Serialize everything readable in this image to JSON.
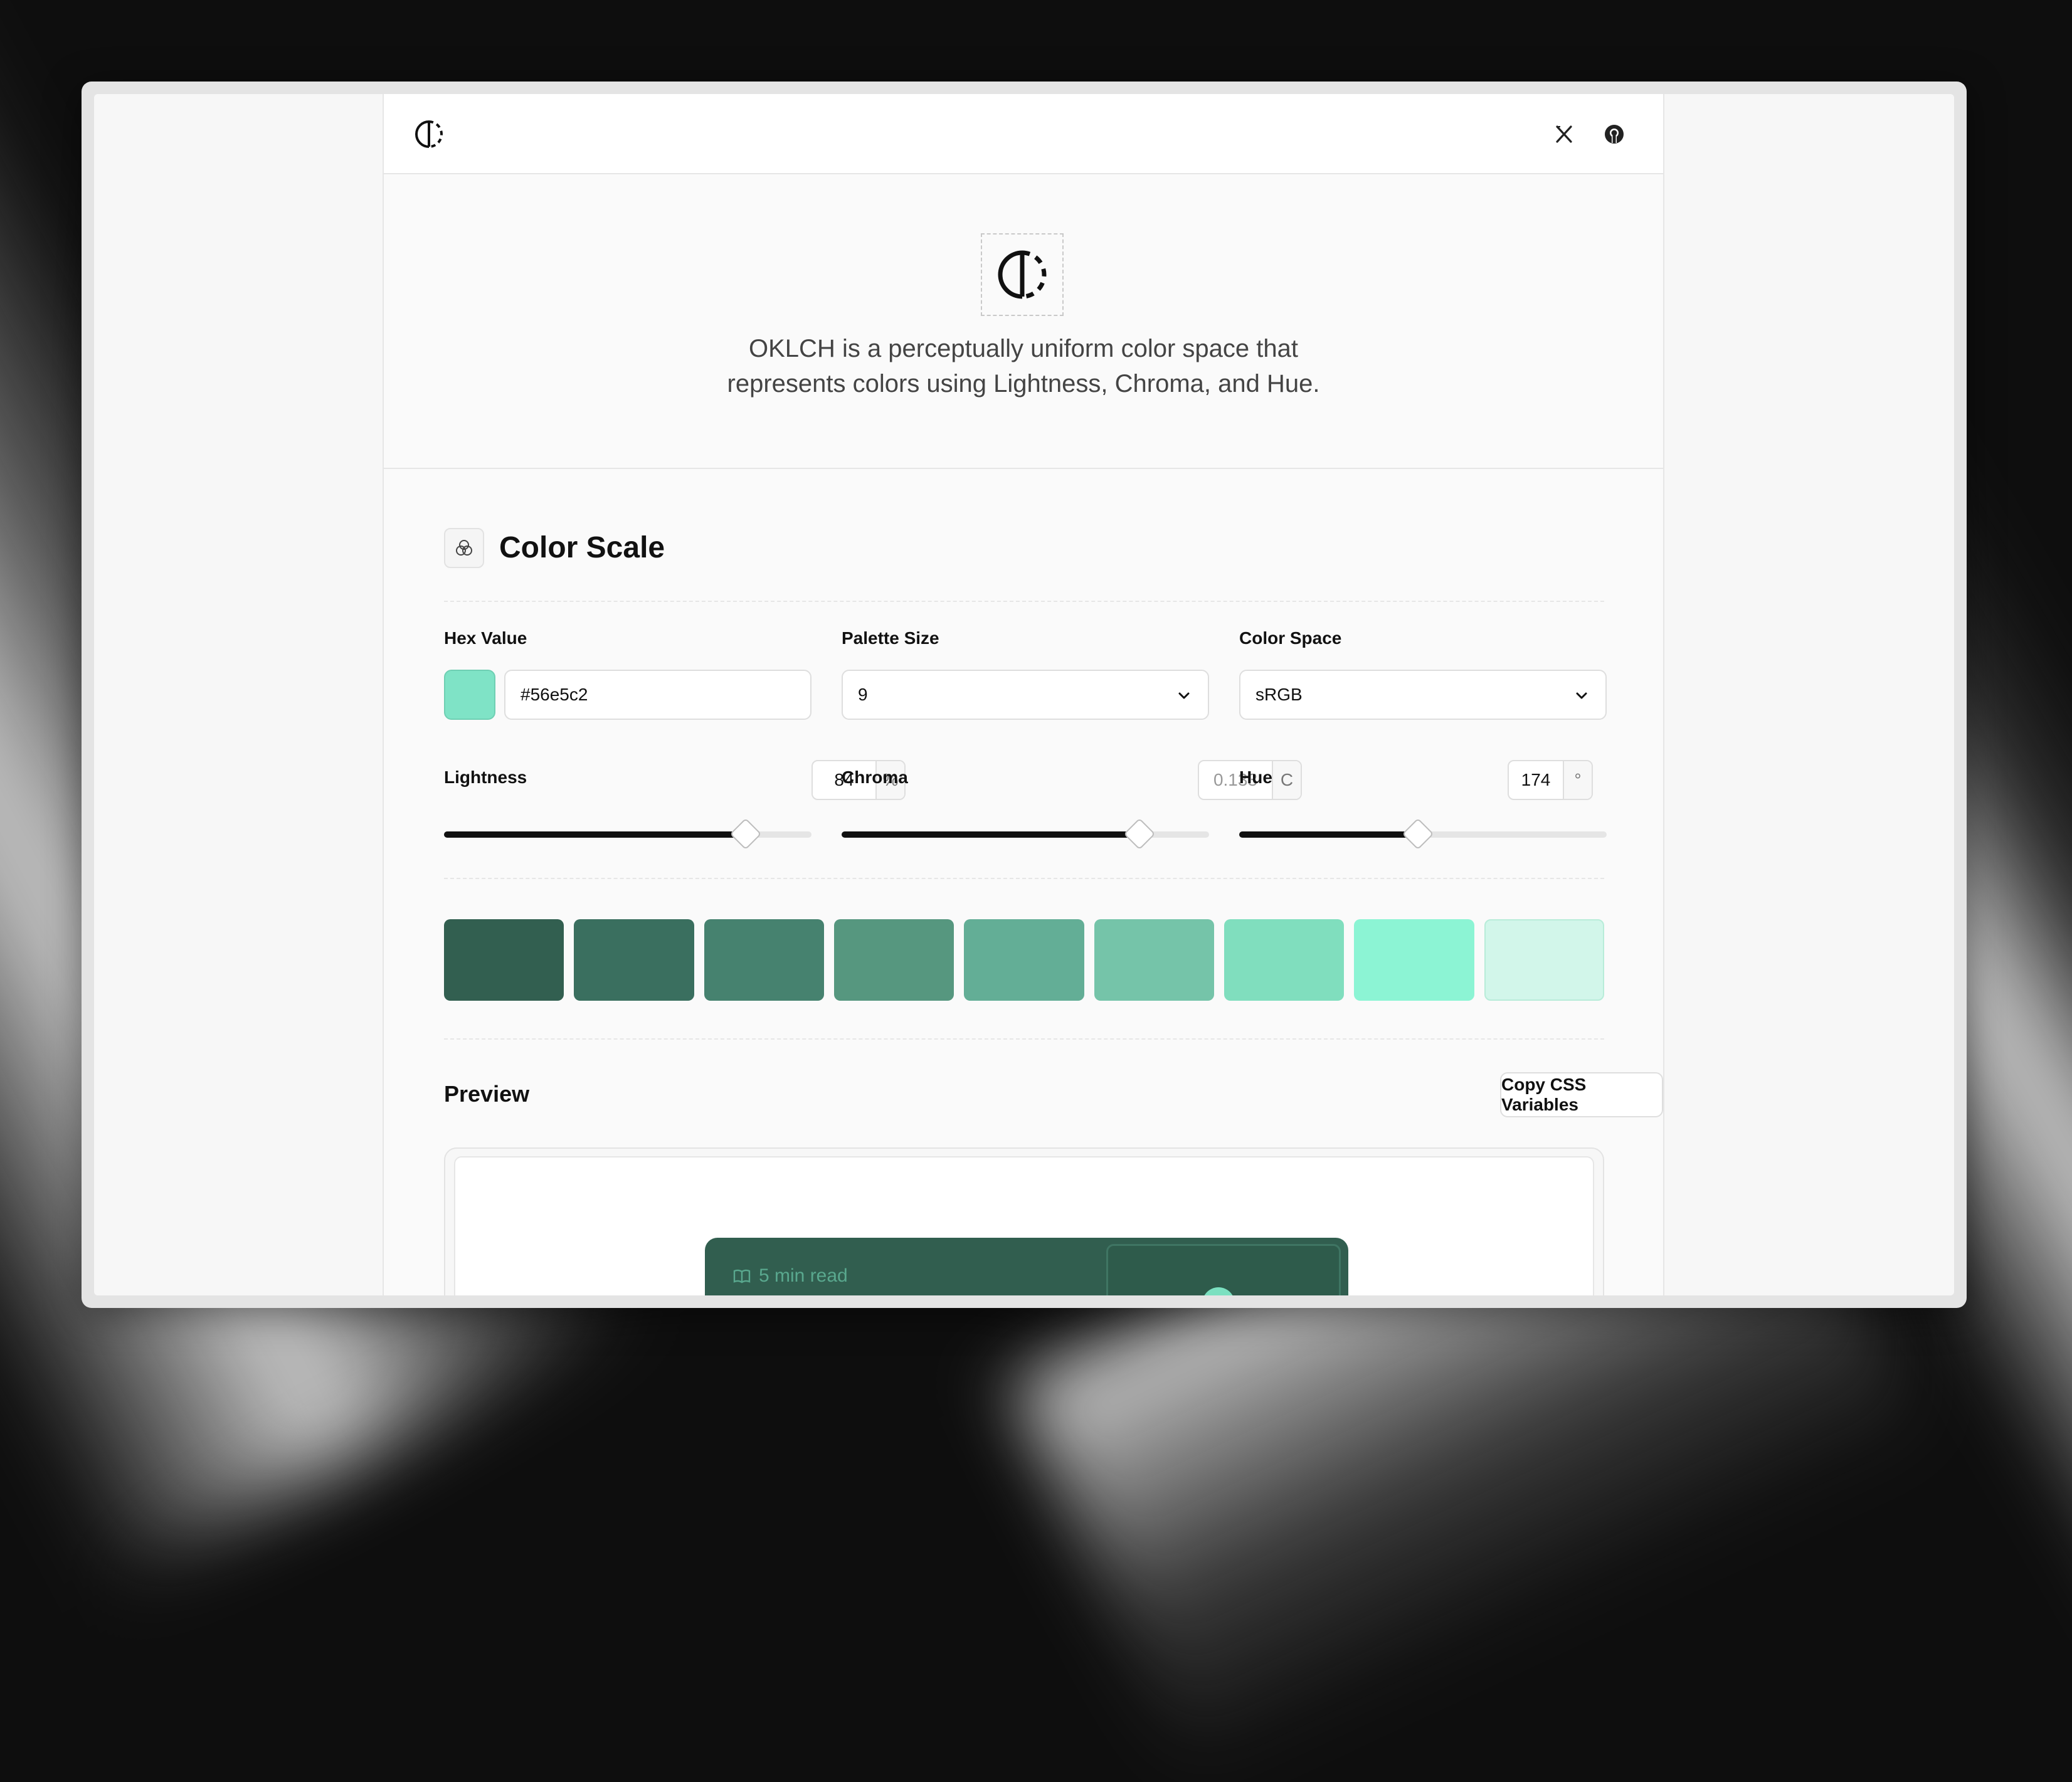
{
  "hero": {
    "description_line1": "OKLCH is a perceptually uniform color space that",
    "description_line2": "represents colors using Lightness, Chroma, and Hue."
  },
  "header": {
    "icons": [
      "logo-icon",
      "x-icon",
      "github-icon"
    ]
  },
  "color_scale": {
    "title": "Color Scale",
    "hex": {
      "label": "Hex Value",
      "value": "#56e5c2",
      "swatch_color": "#7fe3c6"
    },
    "palette_size": {
      "label": "Palette Size",
      "value": "9"
    },
    "color_space": {
      "label": "Color Space",
      "value": "sRGB"
    },
    "lightness": {
      "label": "Lightness",
      "value": "84",
      "unit": "%",
      "level": 0.82
    },
    "chroma": {
      "label": "Chroma",
      "value": "0.133",
      "unit": "C",
      "level": 0.81
    },
    "hue": {
      "label": "Hue",
      "value": "174",
      "unit": "°",
      "level": 0.486
    },
    "swatches": [
      "#325f50",
      "#3a6f5f",
      "#46826f",
      "#56977f",
      "#63ae96",
      "#75c4a9",
      "#80debe",
      "#8cf4d4",
      "#d2f6ea"
    ]
  },
  "preview": {
    "title": "Preview",
    "copy_button": "Copy CSS Variables",
    "card_read": "5 min read"
  }
}
